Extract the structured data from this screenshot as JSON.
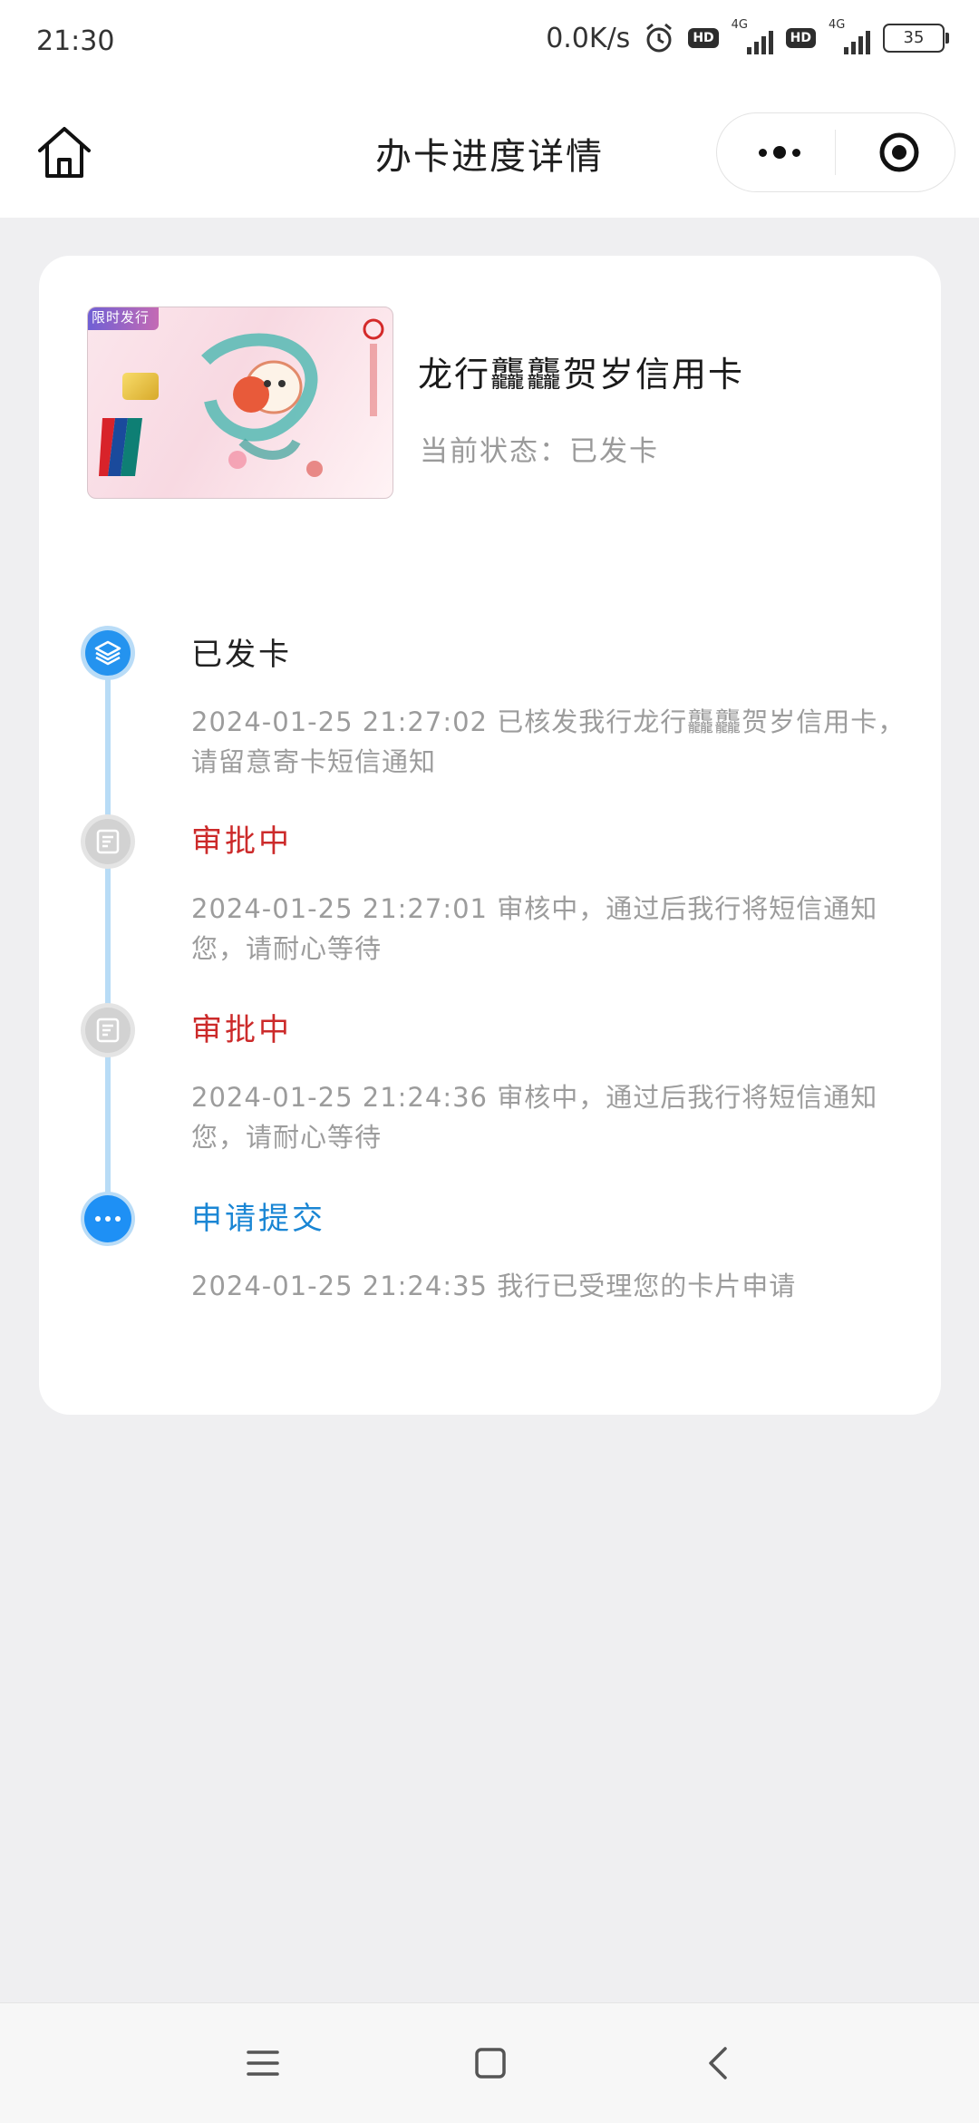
{
  "status_bar": {
    "time": "21:30",
    "net_speed": "0.0K/s",
    "hd_badge": "HD",
    "network_label": "4G",
    "battery": "35"
  },
  "nav": {
    "title": "办卡进度详情"
  },
  "product": {
    "name": "龙行龘龘贺岁信用卡",
    "status": "当前状态：已发卡",
    "card_tag": "限时发行"
  },
  "timeline": [
    {
      "title": "已发卡",
      "desc": "2024-01-25 21:27:02 已核发我行龙行龘龘贺岁信用卡，请留意寄卡短信通知",
      "state": "done"
    },
    {
      "title": "审批中",
      "desc": "2024-01-25 21:27:01 审核中，通过后我行将短信通知您，请耐心等待",
      "state": "reviewing"
    },
    {
      "title": "审批中",
      "desc": "2024-01-25 21:24:36 审核中，通过后我行将短信通知您，请耐心等待",
      "state": "reviewing"
    },
    {
      "title": "申请提交",
      "desc": "2024-01-25 21:24:35 我行已受理您的卡片申请",
      "state": "submitted"
    }
  ],
  "colors": {
    "accent_blue": "#1e90f5",
    "reviewing_red": "#cc2a2a",
    "submitted_blue": "#1a86d4",
    "timeline_line": "#b8dcf6"
  }
}
